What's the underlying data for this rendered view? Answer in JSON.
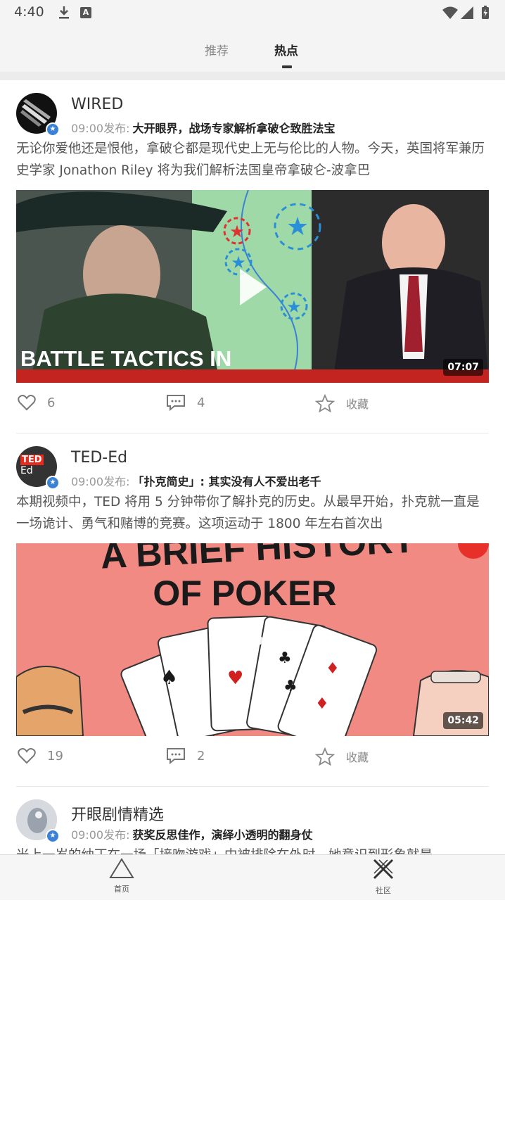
{
  "status_bar": {
    "time": "4:40",
    "icons": [
      "download-icon",
      "a-notification-icon",
      "wifi-icon",
      "signal-icon",
      "battery-icon"
    ]
  },
  "header": {
    "tabs": [
      {
        "label": "推荐",
        "active": false
      },
      {
        "label": "热点",
        "active": true
      }
    ]
  },
  "feed": {
    "cards": [
      {
        "author": "WIRED",
        "time": "09:00发布:",
        "title": "大开眼界，战场专家解析拿破仑致胜法宝",
        "description": "无论你爱他还是恨他，拿破仑都是现代史上无与伦比的人物。今天，英国将军兼历史学家 Jonathon Riley 将为我们解析法国皇帝拿破仑-波拿巴",
        "thumbnail_text": "BATTLE TACTICS IN",
        "duration": "07:07",
        "likes": "6",
        "comments": "4",
        "favorite_label": "收藏"
      },
      {
        "author": "TED-Ed",
        "time": "09:00发布:",
        "title": "「扑克简史」: 其实没有人不爱出老千",
        "description": "本期视频中，TED 将用 5 分钟带你了解扑克的历史。从最早开始，扑克就一直是一场诡计、勇气和赌博的竞赛。这项运动于 1800 年左右首次出",
        "thumbnail_text_line1": "A BRIEF HISTORY",
        "thumbnail_text_line2": "OF POKER",
        "avatar_text_line1": "TED",
        "avatar_text_line2": "Ed",
        "duration": "05:42",
        "likes": "19",
        "comments": "2",
        "favorite_label": "收藏"
      },
      {
        "author": "开眼剧情精选",
        "time": "09:00发布:",
        "title": "获奖反思佳作，演绎小透明的翻身仗",
        "description": "米上一岁的纳丁在一场「接吻游戏」中被排除在外时，她意识到形象就是"
      }
    ]
  },
  "bottom_nav": {
    "items": [
      {
        "label": "首页",
        "icon": "triangle-home-icon"
      },
      {
        "label": "社区",
        "icon": "community-x-icon"
      }
    ]
  },
  "colors": {
    "background": "#ffffff",
    "header_bg": "#f4f4f4",
    "verified_badge": "#3b82d6",
    "poker_bg": "#f28a84",
    "map_bg": "#9fd9a7"
  }
}
